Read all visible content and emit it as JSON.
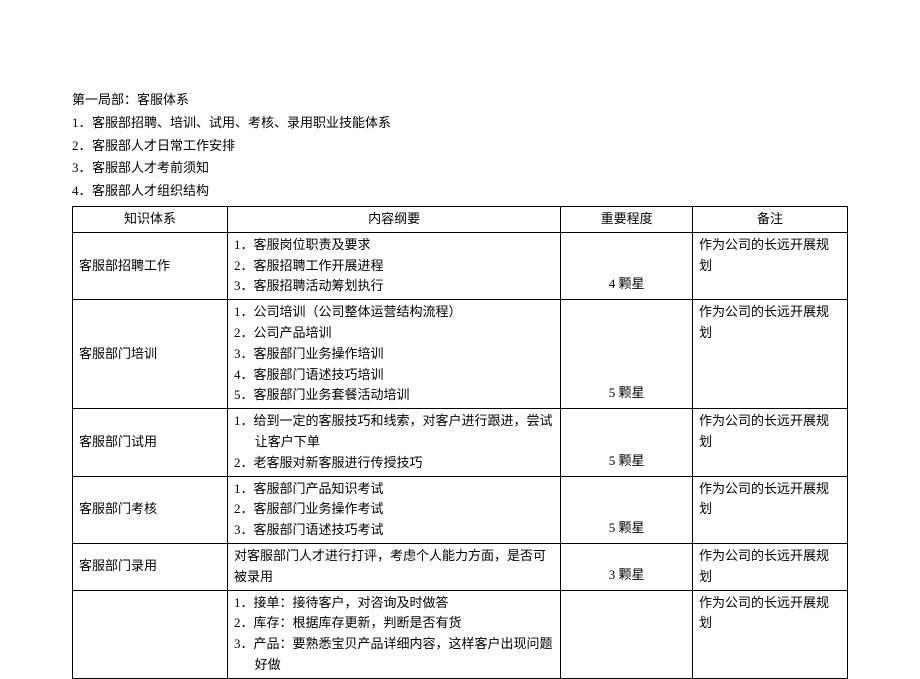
{
  "header": {
    "title": "第一局部：客服体系",
    "lines": [
      "客服部招聘、培训、试用、考核、录用职业技能体系",
      "客服部人才日常工作安排",
      "客服部人才考前须知",
      "客服部人才组织结构"
    ]
  },
  "table": {
    "headers": {
      "system": "知识体系",
      "content": "内容纲要",
      "importance": "重要程度",
      "note": "备注"
    },
    "rows": [
      {
        "system": "客服部招聘工作",
        "content_type": "ol",
        "content": [
          "客服岗位职责及要求",
          "客服招聘工作开展进程",
          "客服招聘活动筹划执行"
        ],
        "importance": "4 颗星",
        "note": "作为公司的长远开展规划"
      },
      {
        "system": "客服部门培训",
        "content_type": "ol",
        "content": [
          "公司培训（公司整体运营结构流程）",
          "公司产品培训",
          "客服部门业务操作培训",
          "客服部门语述技巧培训",
          "客服部门业务套餐活动培训"
        ],
        "importance": "5 颗星",
        "note": "作为公司的长远开展规划"
      },
      {
        "system": "客服部门试用",
        "content_type": "ol",
        "content": [
          "给到一定的客服技巧和线索，对客户进行跟进，尝试让客户下单",
          "老客服对新客服进行传授技巧"
        ],
        "importance": "5 颗星",
        "note": "作为公司的长远开展规划"
      },
      {
        "system": "客服部门考核",
        "content_type": "ol",
        "content": [
          "客服部门产品知识考试",
          "客服部门业务操作考试",
          "客服部门语述技巧考试"
        ],
        "importance": "5 颗星",
        "note": "作为公司的长远开展规划"
      },
      {
        "system": "客服部门录用",
        "content_type": "plain",
        "content_text": "对客服部门人才进行打评，考虑个人能力方面，是否可被录用",
        "importance": "3 颗星",
        "note": "作为公司的长远开展规划"
      },
      {
        "system": "",
        "content_type": "ol",
        "content": [
          "接单：接待客户，对咨询及时做答",
          "库存：根据库存更新，判断是否有货",
          "产品：要熟悉宝贝产品详细内容，这样客户出现问题好做"
        ],
        "importance": "",
        "note": "作为公司的长远开展规划"
      }
    ]
  }
}
